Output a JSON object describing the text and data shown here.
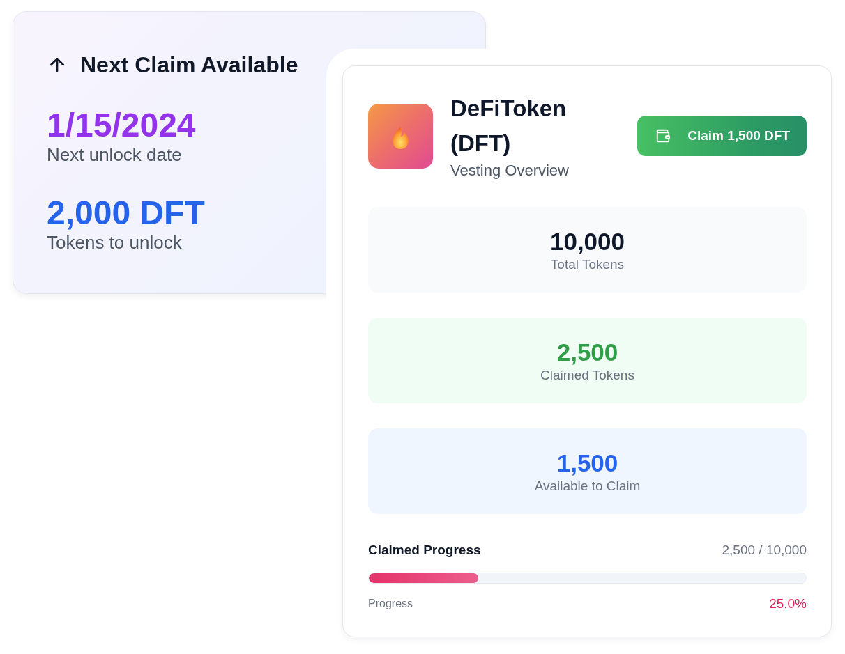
{
  "next_claim": {
    "title": "Next Claim Available",
    "stats": [
      {
        "kind": "date",
        "value": "1/15/2024",
        "label": "Next unlock date"
      },
      {
        "kind": "amount",
        "value": "2,000 DFT",
        "label": "Tokens to unlock"
      }
    ]
  },
  "vesting": {
    "token_name": "DeFiToken (DFT)",
    "subtitle": "Vesting Overview",
    "claim_button": "Claim 1,500 DFT",
    "stats": [
      {
        "kind": "total",
        "value": "10,000",
        "label": "Total Tokens"
      },
      {
        "kind": "claimed",
        "value": "2,500",
        "label": "Claimed Tokens"
      },
      {
        "kind": "available",
        "value": "1,500",
        "label": "Available to Claim"
      }
    ],
    "progress": {
      "title": "Claimed Progress",
      "reading": "2,500 / 10,000",
      "label": "Progress",
      "percent": "25.0%",
      "level": 0.25
    }
  }
}
